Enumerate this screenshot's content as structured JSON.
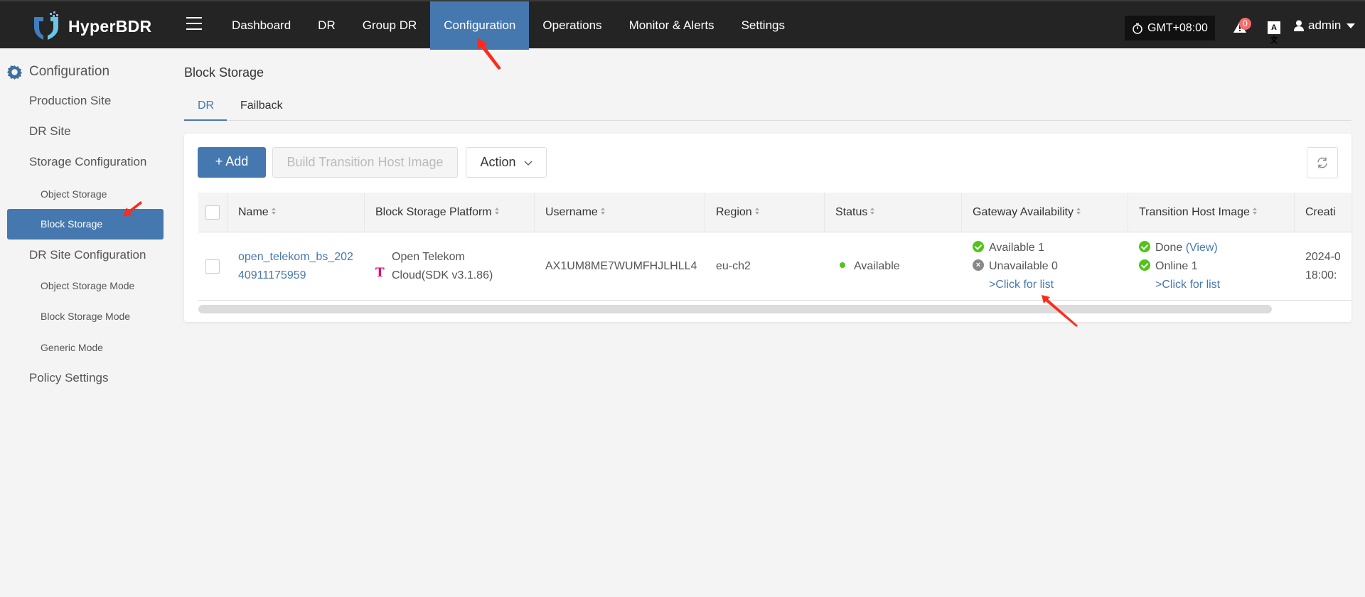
{
  "app": {
    "name": "HyperBDR",
    "brand_color": "#4678b0"
  },
  "topnav": {
    "items": [
      {
        "label": "Dashboard",
        "active": false
      },
      {
        "label": "DR",
        "active": false
      },
      {
        "label": "Group DR",
        "active": false
      },
      {
        "label": "Configuration",
        "active": true
      },
      {
        "label": "Operations",
        "active": false
      },
      {
        "label": "Monitor & Alerts",
        "active": false
      },
      {
        "label": "Settings",
        "active": false
      }
    ],
    "timezone": "GMT+08:00",
    "alert_count": "0",
    "translate_icon": "A文",
    "user": "admin"
  },
  "sidebar": {
    "header": "Configuration",
    "items": [
      {
        "label": "Production Site",
        "level": 1
      },
      {
        "label": "DR Site",
        "level": 1
      },
      {
        "label": "Storage Configuration",
        "level": 1
      },
      {
        "label": "Object Storage",
        "level": 2
      },
      {
        "label": "Block Storage",
        "level": 2,
        "active": true
      },
      {
        "label": "DR Site Configuration",
        "level": 1
      },
      {
        "label": "Object Storage Mode",
        "level": 2
      },
      {
        "label": "Block Storage Mode",
        "level": 2
      },
      {
        "label": "Generic Mode",
        "level": 2
      },
      {
        "label": "Policy Settings",
        "level": 1
      }
    ]
  },
  "page": {
    "title": "Block Storage",
    "tabs": [
      {
        "label": "DR",
        "active": true
      },
      {
        "label": "Failback",
        "active": false
      }
    ]
  },
  "toolbar": {
    "add_label": "+ Add",
    "build_label": "Build Transition Host Image",
    "action_label": "Action"
  },
  "table": {
    "columns": [
      "Name",
      "Block Storage Platform",
      "Username",
      "Region",
      "Status",
      "Gateway Availability",
      "Transition Host Image",
      "Creati"
    ],
    "rows": [
      {
        "name_line1": "open_telekom_bs_202",
        "name_line2": "40911175959",
        "platform_line1": "Open Telekom",
        "platform_line2": "Cloud(SDK v3.1.86)",
        "platform_icon": "T",
        "username": "AX1UM8ME7WUMFHJLHLL4",
        "region": "eu-ch2",
        "status": "Available",
        "gateway_available": "Available 1",
        "gateway_unavailable": "Unavailable 0",
        "gateway_link": ">Click for list",
        "image_status": "Done",
        "image_view": "(View)",
        "image_online": "Online 1",
        "image_link": ">Click for list",
        "created_line1": "2024-0",
        "created_line2": "18:00:"
      }
    ]
  },
  "colors": {
    "success": "#52c41a",
    "telekom": "#e20074",
    "annotation": "#ff2a1a"
  }
}
